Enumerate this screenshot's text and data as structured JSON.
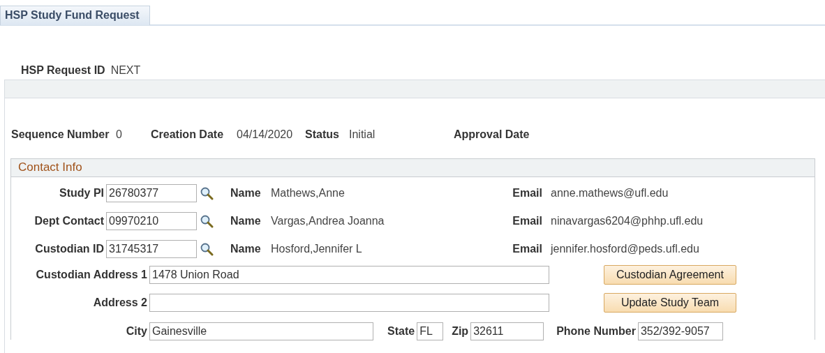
{
  "tabs": [
    {
      "label": "HSP Study Fund Request",
      "selected": true
    }
  ],
  "request_id": {
    "label": "HSP Request ID",
    "value": "NEXT"
  },
  "summary": [
    {
      "label": "Sequence Number",
      "value": "0"
    },
    {
      "label": "Creation Date",
      "value": "04/14/2020"
    },
    {
      "label": "Status",
      "value": "Initial"
    },
    {
      "label": "Approval Date"
    }
  ],
  "contact_info": {
    "title": "Contact Info",
    "people": [
      {
        "label": "Study PI",
        "id": "26780377",
        "name_label": "Name",
        "name": "Mathews,Anne",
        "email_label": "Email",
        "email": "anne.mathews@ufl.edu"
      },
      {
        "label": "Dept Contact",
        "id": "09970210",
        "name_label": "Name",
        "name": "Vargas,Andrea Joanna",
        "email_label": "Email",
        "email": "ninavargas6204@phhp.ufl.edu"
      },
      {
        "label": "Custodian ID",
        "id": "31745317",
        "name_label": "Name",
        "name": "Hosford,Jennifer L",
        "email_label": "Email",
        "email": "jennifer.hosford@peds.ufl.edu"
      }
    ],
    "address_1": {
      "label": "Custodian Address 1",
      "value": "1478 Union Road"
    },
    "address_2": {
      "label": "Address 2"
    },
    "buttons": [
      "Custodian Agreement",
      "Update Study Team"
    ],
    "city": {
      "label": "City",
      "value": "Gainesville"
    },
    "state": {
      "label": "State",
      "value": "FL"
    },
    "zip": {
      "label": "Zip",
      "value": "32611"
    },
    "phone": {
      "label": "Phone Number",
      "value": "352/392-9057"
    }
  }
}
